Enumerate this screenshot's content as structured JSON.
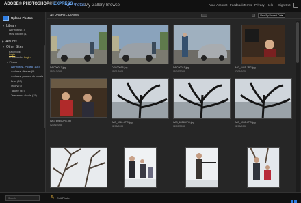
{
  "header": {
    "logo_text": "ADOBE® PHOTOSHOP® ",
    "logo_express": "EXPRESS",
    "beta": "BETA",
    "nav": [
      "My Photos",
      "My Gallery",
      "Browse"
    ],
    "util": [
      "Your Account",
      "Feedback",
      "Terms",
      "Privacy",
      "Help",
      "Sign Out"
    ]
  },
  "sidebar": {
    "upload_label": "Upload Photos",
    "library": "Library",
    "library_items": [
      "All Photos (1)",
      "Most Recent (1)"
    ],
    "albums": "Albums",
    "other_sites": "Other Sites",
    "facebook": "Facebook",
    "photobucket": "Photobucket",
    "login": "Login",
    "picasa": "Picasa",
    "picasa_items": [
      "All Photos - Picasa (108)",
      "Andreea, diverse (9)",
      "Andreea, prima zi de scoala...",
      "Bran (20)",
      "vfoory (3)",
      "Taluwe (84)",
      "Telesemba chicile (15)"
    ]
  },
  "toolbar": {
    "crumb": "All Photos - Picasa",
    "view_select": "View By Newest Date"
  },
  "photos": [
    {
      "name": "DSC00017.jpg",
      "date": "05/01/2008",
      "scene": "car"
    },
    {
      "name": "DSC00016.jpg",
      "date": "05/01/2008",
      "scene": "car"
    },
    {
      "name": "DSC00015.jpg",
      "date": "05/01/2008",
      "scene": "car-dark"
    },
    {
      "name": "IMG_6465.JPG.jpg",
      "date": "02/05/2008",
      "scene": "indoor"
    },
    {
      "name": "IMG_6964.JPG.jpg",
      "date": "02/05/2008",
      "scene": "indoor2"
    },
    {
      "name": "IMG_6961.JPG.jpg",
      "date": "02/05/2008",
      "scene": "plant"
    },
    {
      "name": "IMG_6958.JPG.jpg",
      "date": "02/05/2008",
      "scene": "plant"
    },
    {
      "name": "IMG_6955.JPG.jpg",
      "date": "02/05/2008",
      "scene": "plant"
    },
    {
      "name": "",
      "date": "",
      "scene": "snowtree"
    },
    {
      "name": "",
      "date": "",
      "scene": "people-snow"
    },
    {
      "name": "",
      "date": "",
      "scene": "gun"
    },
    {
      "name": "",
      "date": "",
      "scene": "kids-snow"
    }
  ],
  "footer": {
    "search_placeholder": "Search",
    "edit_label": "Edit Photo"
  }
}
